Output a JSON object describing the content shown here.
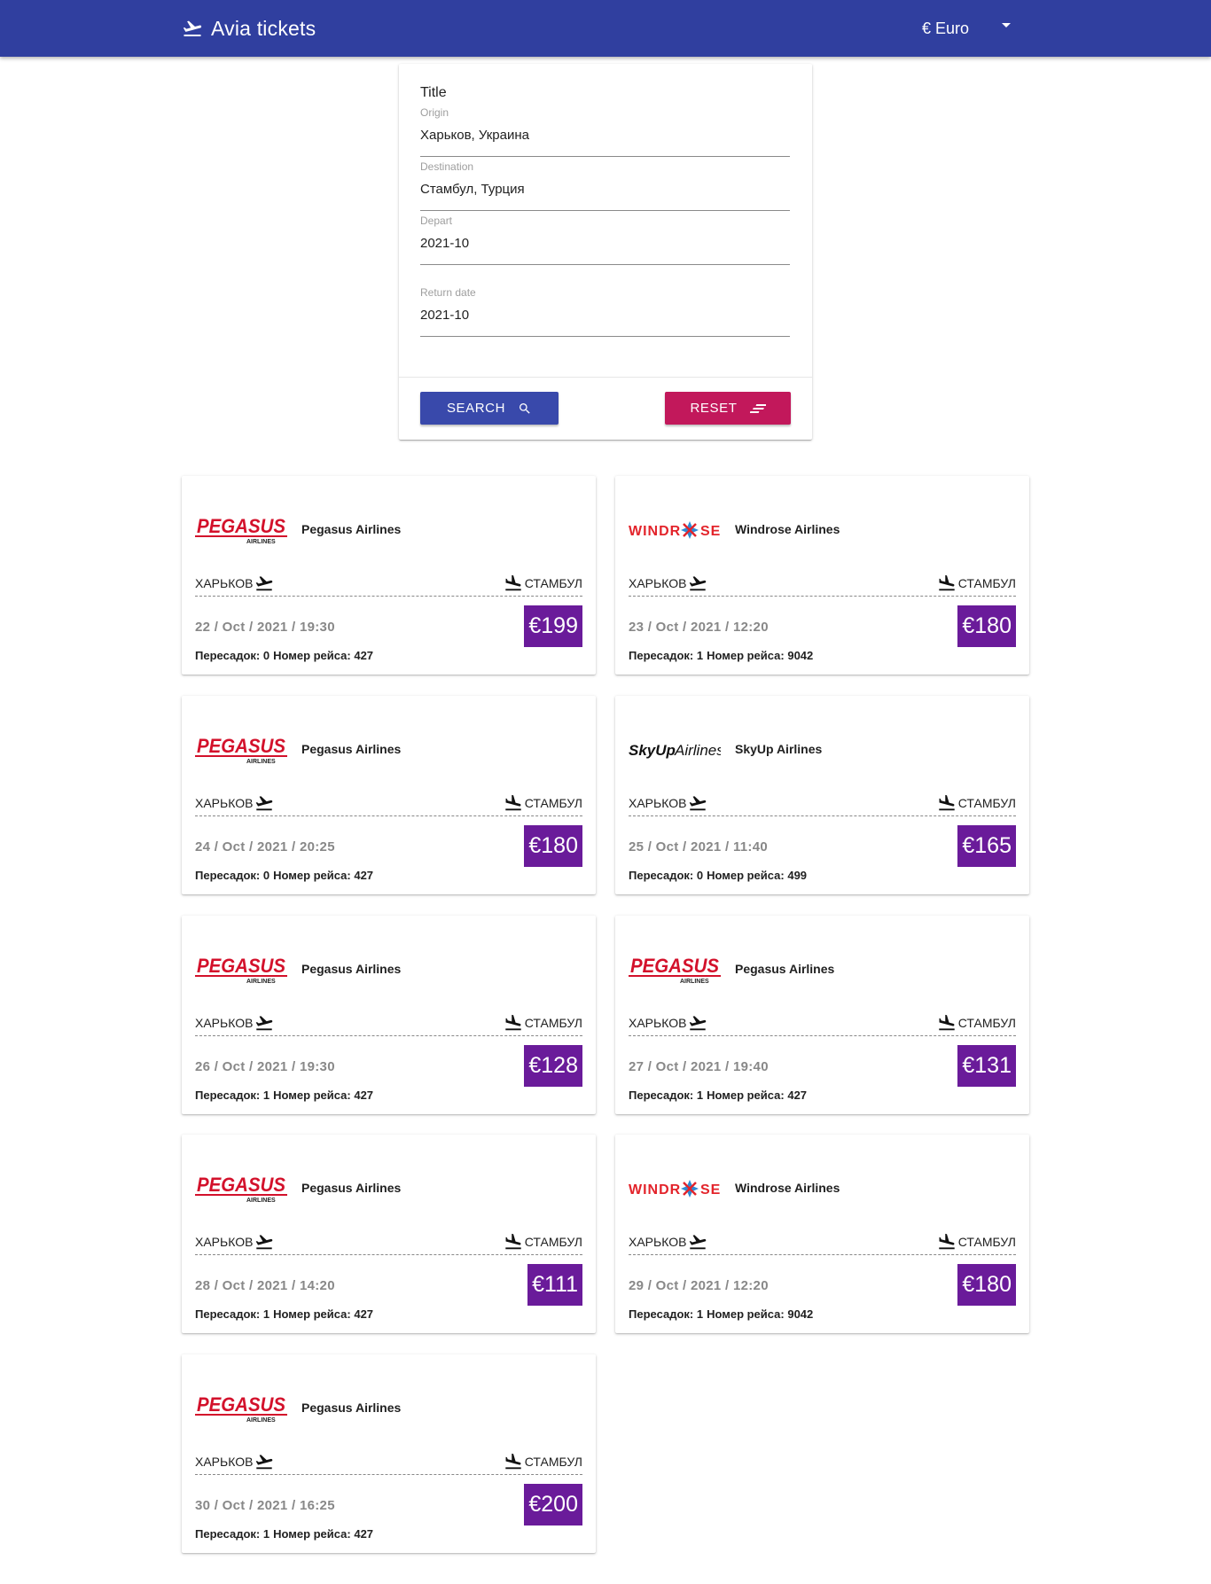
{
  "appbar": {
    "title": "Avia tickets",
    "currency": "€ Euro"
  },
  "form": {
    "title": "Title",
    "origin": {
      "label": "Origin",
      "value": "Харьков, Украина"
    },
    "destination": {
      "label": "Destination",
      "value": "Стамбул, Турция"
    },
    "depart": {
      "label": "Depart",
      "value": "2021-10"
    },
    "return_date": {
      "label": "Return date",
      "value": "2021-10"
    },
    "search_label": "SEARCH",
    "reset_label": "RESET"
  },
  "tickets": [
    {
      "logo": "pegasus",
      "airline": "Pegasus Airlines",
      "origin": "ХАРЬКОВ",
      "destination": "СТАМБУЛ",
      "date": "22 / Oct / 2021 / 19:30",
      "price": "€199",
      "transfers": "Пересадок: 0",
      "flight": "Номер рейса: 427"
    },
    {
      "logo": "windrose",
      "airline": "Windrose Airlines",
      "origin": "ХАРЬКОВ",
      "destination": "СТАМБУЛ",
      "date": "23 / Oct / 2021 / 12:20",
      "price": "€180",
      "transfers": "Пересадок: 1",
      "flight": "Номер рейса: 9042"
    },
    {
      "logo": "pegasus",
      "airline": "Pegasus Airlines",
      "origin": "ХАРЬКОВ",
      "destination": "СТАМБУЛ",
      "date": "24 / Oct / 2021 / 20:25",
      "price": "€180",
      "transfers": "Пересадок: 0",
      "flight": "Номер рейса: 427"
    },
    {
      "logo": "skyup",
      "airline": "SkyUp Airlines",
      "origin": "ХАРЬКОВ",
      "destination": "СТАМБУЛ",
      "date": "25 / Oct / 2021 / 11:40",
      "price": "€165",
      "transfers": "Пересадок: 0",
      "flight": "Номер рейса: 499"
    },
    {
      "logo": "pegasus",
      "airline": "Pegasus Airlines",
      "origin": "ХАРЬКОВ",
      "destination": "СТАМБУЛ",
      "date": "26 / Oct / 2021 / 19:30",
      "price": "€128",
      "transfers": "Пересадок: 1",
      "flight": "Номер рейса: 427"
    },
    {
      "logo": "pegasus",
      "airline": "Pegasus Airlines",
      "origin": "ХАРЬКОВ",
      "destination": "СТАМБУЛ",
      "date": "27 / Oct / 2021 / 19:40",
      "price": "€131",
      "transfers": "Пересадок: 1",
      "flight": "Номер рейса: 427"
    },
    {
      "logo": "pegasus",
      "airline": "Pegasus Airlines",
      "origin": "ХАРЬКОВ",
      "destination": "СТАМБУЛ",
      "date": "28 / Oct / 2021 / 14:20",
      "price": "€111",
      "transfers": "Пересадок: 1",
      "flight": "Номер рейса: 427"
    },
    {
      "logo": "windrose",
      "airline": "Windrose Airlines",
      "origin": "ХАРЬКОВ",
      "destination": "СТАМБУЛ",
      "date": "29 / Oct / 2021 / 12:20",
      "price": "€180",
      "transfers": "Пересадок: 1",
      "flight": "Номер рейса: 9042"
    },
    {
      "logo": "pegasus",
      "airline": "Pegasus Airlines",
      "origin": "ХАРЬКОВ",
      "destination": "СТАМБУЛ",
      "date": "30 / Oct / 2021 / 16:25",
      "price": "€200",
      "transfers": "Пересадок: 1",
      "flight": "Номер рейса: 427"
    }
  ],
  "logos": {
    "pegasus": {
      "word": "PEGASUS",
      "sub": "AIRLINES"
    },
    "windrose": {
      "left": "WINDR",
      "right": "SE"
    },
    "skyup": {
      "bold": "SkyUp",
      "light": "Airlines"
    }
  },
  "colors": {
    "appbar": "#303f9f",
    "search_button": "#3949ab",
    "reset_button": "#c2185b",
    "price_badge": "#6a1b9a",
    "pegasus_red": "#d3112b",
    "windrose_red": "#e3242b",
    "windrose_blue": "#2e8bd6"
  },
  "icons": {
    "brand": "flight-takeoff-icon",
    "search": "search-icon",
    "reset": "sort-icon",
    "departure": "flight-takeoff-icon",
    "arrival": "flight-land-icon",
    "currency_caret": "caret-down-icon"
  }
}
